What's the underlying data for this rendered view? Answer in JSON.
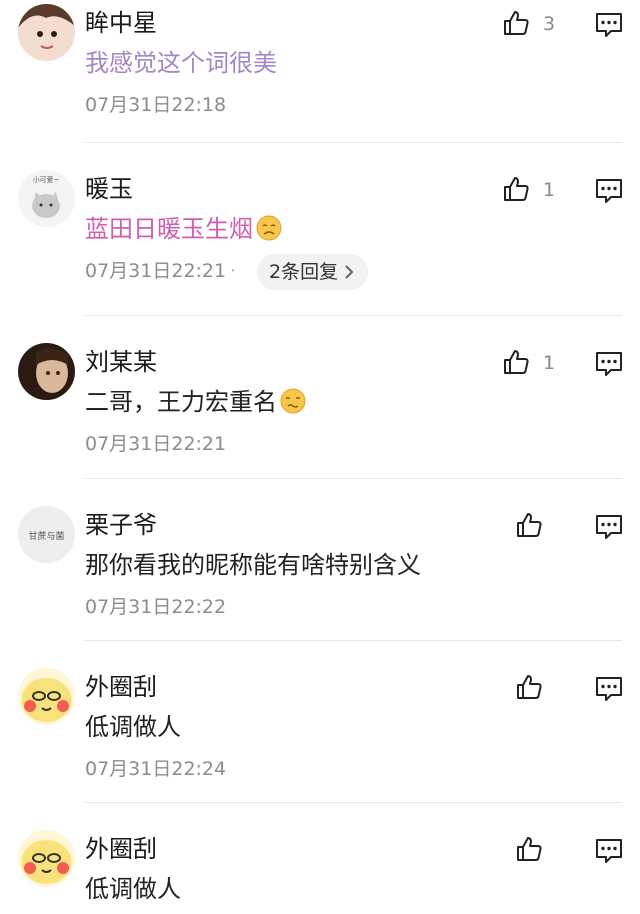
{
  "comments": [
    {
      "name": "眸中星",
      "text": "我感觉这个词很美",
      "time": "07月31日22:18",
      "likes": "3"
    },
    {
      "name": "暖玉",
      "text": "蓝田日暖玉生烟",
      "time": "07月31日22:21",
      "likes": "1",
      "replies": "2条回复",
      "avatar_caption": "小可爱~"
    },
    {
      "name": "刘某某",
      "text": "二哥，王力宏重名",
      "time": "07月31日22:21",
      "likes": "1"
    },
    {
      "name": "栗子爷",
      "text": "那你看我的昵称能有啥特别含义",
      "time": "07月31日22:22",
      "likes": "",
      "avatar_caption": "甘蔗与菌"
    },
    {
      "name": "外圈刮",
      "text": "低调做人",
      "time": "07月31日22:24",
      "likes": ""
    },
    {
      "name": "外圈刮",
      "text": "低调做人",
      "time": "",
      "likes": ""
    }
  ],
  "icons": {
    "like": "thumbs-up-icon",
    "reply": "comment-bubble-icon",
    "chevron": "chevron-right-icon"
  },
  "colors": {
    "purple_text": "#a487c8",
    "pink_text": "#d05fb0",
    "meta_gray": "#8c8c8c"
  }
}
